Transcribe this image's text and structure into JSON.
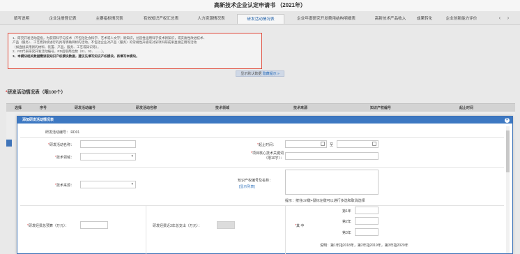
{
  "header": {
    "title": "高新技术企业认定申请书 （2021年）"
  },
  "tabs": [
    {
      "label": "填写说明",
      "active": false
    },
    {
      "label": "企业注册登记表",
      "active": false
    },
    {
      "label": "主要指标情况表",
      "active": false
    },
    {
      "label": "有效知识产权汇总表",
      "active": false
    },
    {
      "label": "人力资源情况表",
      "active": false
    },
    {
      "label": "研发活动情况表",
      "active": true
    },
    {
      "label": "企业年度研究开发费用结构明细表",
      "active": false
    },
    {
      "label": "高新技术产品收入",
      "active": false
    },
    {
      "label": "成果转化",
      "active": false
    },
    {
      "label": "企业创新能力评价",
      "active": false
    }
  ],
  "notice": {
    "lines": [
      "1、研究开发活动是指，为获得科学与技术（不包括社会科学、艺术或人文学）新知识，创造性运用科学技术新知识，或实质性改进技术、",
      "产品（服务）、工艺而持续进行的具有明确目标的活动。不包括企业对产品（服务）的常规性升级或对某项科研成果直接应用等活动",
      "（如直接采用新的材料、装置、产品、服务、工艺或知识等）。",
      "2、RD代表研究开发活动编号，RD后取两位数（01、02、……）。",
      "3、本模块相关数据需读取知识产权模块数据，建议先填写知识产权模块，再填写本模块。"
    ]
  },
  "toggle": {
    "text": "显示默认数据",
    "link": "隐藏提示 »"
  },
  "section": {
    "title": "研发活动情况表（限100个）",
    "required_mark": "*"
  },
  "grid": {
    "columns": [
      "选择",
      "序号",
      "研发活动编号",
      "研发活动名称",
      "技术领域",
      "技术来源",
      "知识产权编号",
      "起止时间"
    ]
  },
  "modal": {
    "title": "添加研发活动情况表",
    "close_icon": "×",
    "rd_number_label": "研发活动编号：",
    "rd_number_value": "RD01",
    "fields": {
      "rd_name_label": "研发活动名称：",
      "start_time_label": "起止时间：",
      "to_label": "至",
      "tech_field_label": "技术领域：",
      "keywords_label": "项目核心技术关键词（限10字）：",
      "tech_source_label": "技术来源：",
      "ip_number_label": "知识产权编号及名称：",
      "ip_link": "[显示列表]",
      "ip_hint": "提示：按住ctrl键+鼠标左键可以进行多选和取消选择",
      "budget_label": "研发经费总预算（万元）：",
      "spend3y_label": "研发经费近3年总支出（万元）：",
      "of_which_label": "其 中",
      "year_labels": [
        "第1年",
        "第2年",
        "第3年"
      ],
      "note": "说明：第1年指2018年，第2年指2019年，第3年指2020年"
    }
  }
}
